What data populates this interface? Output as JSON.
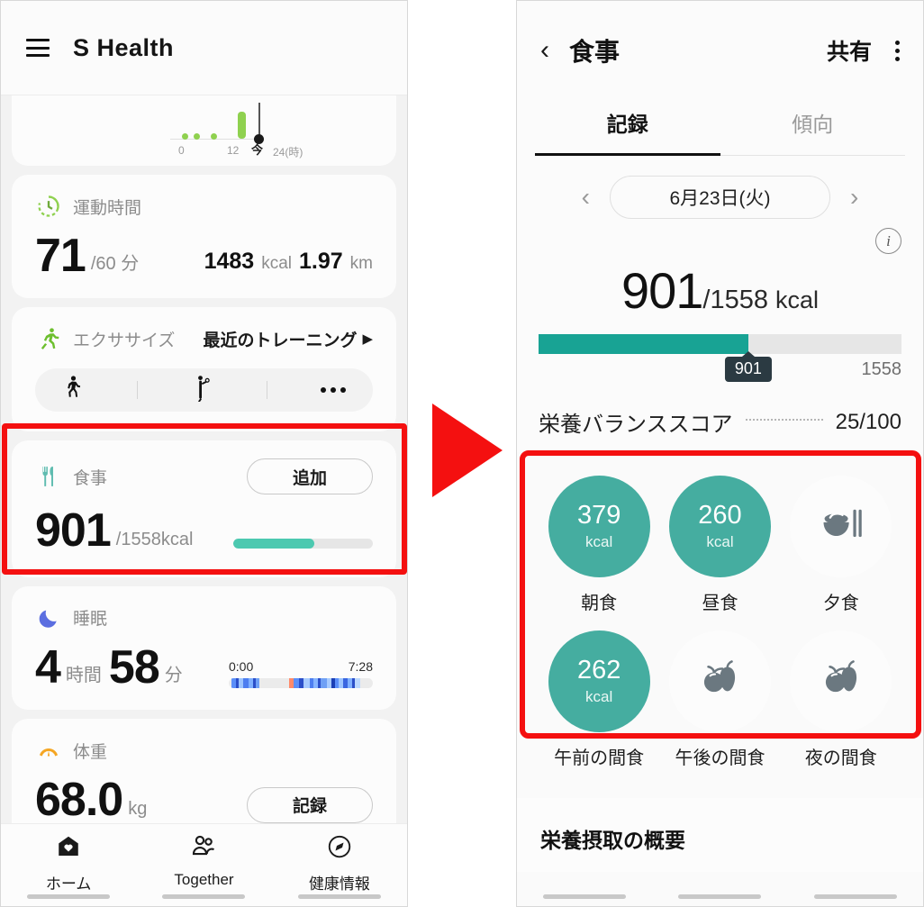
{
  "left_phone": {
    "appbar": {
      "menu_icon": "hamburger-icon",
      "title": "S Health"
    },
    "steps_chart": {
      "x_labels": [
        "0",
        "12",
        "24(時)"
      ],
      "now_label": "今",
      "points": [
        {
          "x": 8,
          "type": "dot"
        },
        {
          "x": 22,
          "type": "dot"
        },
        {
          "x": 40,
          "type": "dot"
        },
        {
          "x": 63,
          "type": "bar",
          "height": 30
        }
      ]
    },
    "exercise_time_card": {
      "icon": "clock-icon",
      "label": "運動時間",
      "value": "71",
      "unit": "/60 分",
      "calories": "1483",
      "calories_unit": "kcal",
      "distance": "1.97",
      "distance_unit": "km"
    },
    "exercise_card": {
      "icon": "running-icon",
      "label": "エクササイズ",
      "recent_link": "最近のトレーニング",
      "recent_arrow": "▶",
      "shortcuts": [
        "walking-icon",
        "workout-icon",
        "more-icon"
      ]
    },
    "meal_card": {
      "icon": "cutlery-icon",
      "label": "食事",
      "add_button": "追加",
      "value": "901",
      "unit": "/1558kcal",
      "progress_percent": 58
    },
    "sleep_card": {
      "icon": "moon-icon",
      "label": "睡眠",
      "hours": "4",
      "hours_unit": "時間",
      "minutes": "58",
      "minutes_unit": "分",
      "start_time": "0:00",
      "end_time": "7:28"
    },
    "weight_card": {
      "icon": "scale-icon",
      "label": "体重",
      "value": "68.0",
      "unit": "kg",
      "record_button": "記録"
    },
    "bottom_nav": [
      {
        "icon": "home-heart-icon",
        "label": "ホーム",
        "active": true
      },
      {
        "icon": "people-icon",
        "label": "Together",
        "active": false
      },
      {
        "icon": "compass-icon",
        "label": "健康情報",
        "active": false
      }
    ]
  },
  "right_phone": {
    "appbar": {
      "back_icon": "back-chevron-icon",
      "title": "食事",
      "share_label": "共有",
      "menu_icon": "kebab-menu-icon"
    },
    "tabs": [
      {
        "label": "記録",
        "active": true
      },
      {
        "label": "傾向",
        "active": false
      }
    ],
    "date_nav": {
      "prev_icon": "chevron-left-icon",
      "date": "6月23日(火)",
      "next_icon": "chevron-right-icon"
    },
    "calorie_summary": {
      "info_icon": "info-icon",
      "consumed": "901",
      "goal": "/1558",
      "unit": "kcal",
      "badge_value": "901",
      "max_label": "1558",
      "progress_percent": 57.8
    },
    "nutrition_score": {
      "label": "栄養バランススコア",
      "value": "25/100"
    },
    "meals": [
      {
        "name": "朝食",
        "value": "379",
        "unit": "kcal",
        "filled": true,
        "icon": ""
      },
      {
        "name": "昼食",
        "value": "260",
        "unit": "kcal",
        "filled": true,
        "icon": ""
      },
      {
        "name": "夕食",
        "value": "",
        "unit": "",
        "filled": false,
        "icon": "rice-bowl-icon"
      },
      {
        "name": "午前の間食",
        "value": "262",
        "unit": "kcal",
        "filled": true,
        "icon": ""
      },
      {
        "name": "午後の間食",
        "value": "",
        "unit": "",
        "filled": false,
        "icon": "fruit-icon"
      },
      {
        "name": "夜の間食",
        "value": "",
        "unit": "",
        "filled": false,
        "icon": "fruit-icon"
      }
    ],
    "nutrition_section": {
      "title": "栄養摂取の概要"
    }
  },
  "annotations": {
    "arrow": "red-right-arrow",
    "highlight_left": "red-highlight-meal-card",
    "highlight_right": "red-highlight-meal-grid"
  },
  "colors": {
    "teal": "#18a394",
    "meal_circle": "#45ada0",
    "progress_light_teal": "#4cc9b0",
    "green": "#8fd14f",
    "red_highlight": "#f41010",
    "orange": "#f5a623"
  }
}
